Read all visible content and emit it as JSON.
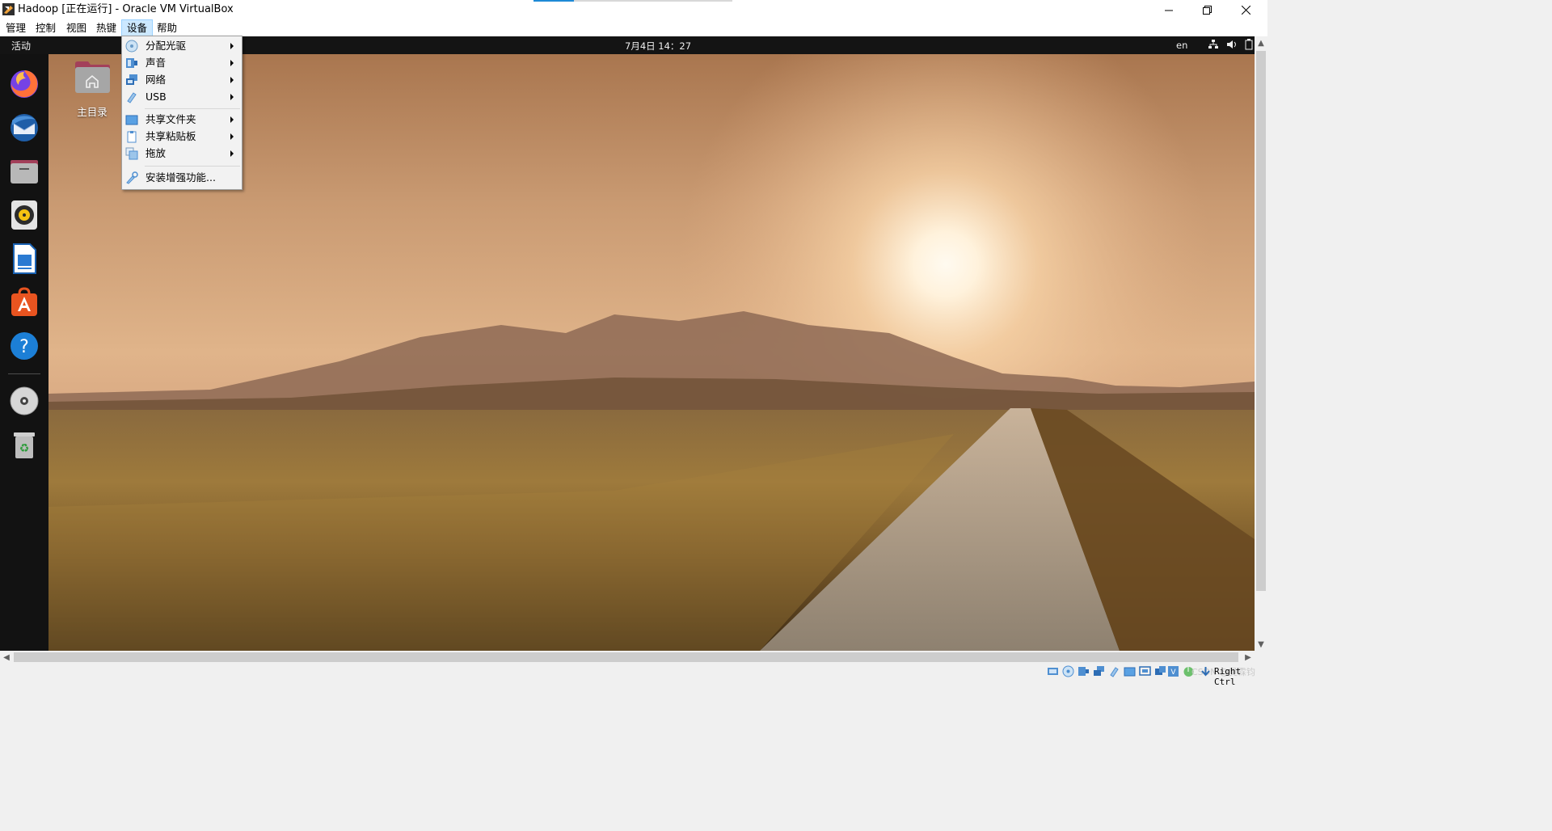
{
  "window": {
    "title": "Hadoop [正在运行] - Oracle VM VirtualBox",
    "buttons": [
      "minimize",
      "restore",
      "close"
    ]
  },
  "menubar": {
    "items": [
      {
        "label": "管理"
      },
      {
        "label": "控制"
      },
      {
        "label": "视图"
      },
      {
        "label": "热键"
      },
      {
        "label": "设备",
        "active": true
      },
      {
        "label": "帮助"
      }
    ]
  },
  "devices_menu": {
    "items": [
      {
        "label": "分配光驱",
        "icon": "optical-disc-icon",
        "submenu": true
      },
      {
        "label": "声音",
        "icon": "audio-icon",
        "submenu": true
      },
      {
        "label": "网络",
        "icon": "network-icon",
        "submenu": true
      },
      {
        "label": "USB",
        "icon": "usb-icon",
        "submenu": true
      },
      {
        "label": "共享文件夹",
        "icon": "shared-folder-icon",
        "submenu": true
      },
      {
        "label": "共享粘贴板",
        "icon": "clipboard-icon",
        "submenu": true
      },
      {
        "label": "拖放",
        "icon": "drag-drop-icon",
        "submenu": true
      },
      {
        "label": "安装增强功能...",
        "icon": "guest-additions-icon",
        "submenu": false
      }
    ]
  },
  "guest": {
    "topbar": {
      "activities": "活动",
      "clock": "7月4日  14：27",
      "language": "en",
      "tray_icons": [
        "network-icon",
        "volume-icon",
        "battery-icon"
      ]
    },
    "dock": {
      "apps": [
        "firefox-icon",
        "thunderbird-icon",
        "files-icon",
        "rhythmbox-icon",
        "libreoffice-writer-icon",
        "software-center-icon",
        "help-icon",
        "dvd-drive-icon",
        "trash-icon"
      ]
    },
    "desktop": {
      "home_folder_label": "主目录"
    }
  },
  "statusbar": {
    "host_key": "Right Ctrl",
    "watermark": "CSDN @吴霖钧"
  },
  "colors": {
    "menu_active_bg": "#cce8ff",
    "menu_active_border": "#99d1ff",
    "guest_topbar": "#141414",
    "dock_bg": "#1e1e1e"
  }
}
